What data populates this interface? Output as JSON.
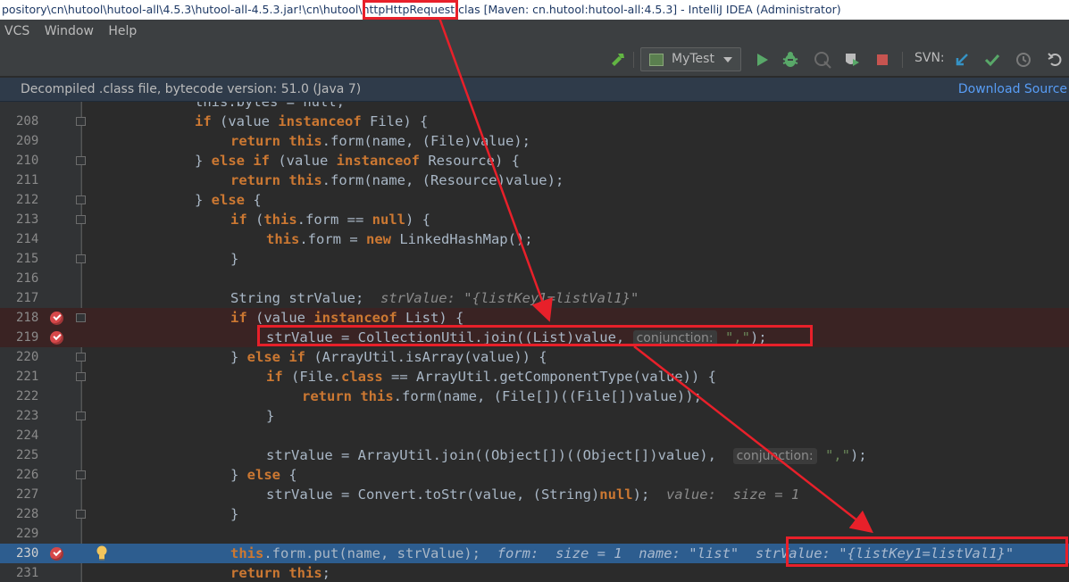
{
  "titlebar": {
    "text_before": "pository\\cn\\hutool\\hutool-all\\4.5.3\\hutool-all-4.5.3.jar!\\cn\\hutool\\http",
    "text_highlight": "HttpRequest.clas",
    "text_after": " [Maven: cn.hutool:hutool-all:4.5.3] - IntelliJ IDEA (Administrator)"
  },
  "menu": {
    "vcs": "VCS",
    "window": "Window",
    "help": "Help"
  },
  "toolbar": {
    "run_config": "MyTest",
    "svn_label": "SVN:"
  },
  "infobar": {
    "message": "Decompiled .class file, bytecode version: 51.0 (Java 7)",
    "download_link": "Download Source"
  },
  "code": {
    "l207": {
      "num": "",
      "text": "this.bytes = null;"
    },
    "l208": {
      "num": "208"
    },
    "l209": {
      "num": "209"
    },
    "l210": {
      "num": "210"
    },
    "l211": {
      "num": "211"
    },
    "l212": {
      "num": "212"
    },
    "l213": {
      "num": "213"
    },
    "l214": {
      "num": "214"
    },
    "l215": {
      "num": "215"
    },
    "l216": {
      "num": "216"
    },
    "l217": {
      "num": "217",
      "inline": "strValue: \"{listKey1=listVal1}\""
    },
    "l218": {
      "num": "218"
    },
    "l219": {
      "num": "219",
      "hint": "conjunction:",
      "str": "\",\""
    },
    "l220": {
      "num": "220"
    },
    "l221": {
      "num": "221"
    },
    "l222": {
      "num": "222"
    },
    "l223": {
      "num": "223"
    },
    "l224": {
      "num": "224"
    },
    "l225": {
      "num": "225",
      "hint": "conjunction:",
      "str": "\",\""
    },
    "l226": {
      "num": "226"
    },
    "l227": {
      "num": "227",
      "inline": "value:  size = 1"
    },
    "l228": {
      "num": "228"
    },
    "l229": {
      "num": "229"
    },
    "l230": {
      "num": "230",
      "inline1": "form:  size = 1  name: \"list\"",
      "inline2": "strValue: \"{listKey1=listVal1}\""
    },
    "l231": {
      "num": "231"
    }
  },
  "colors": {
    "keyword": "#cc7832",
    "string": "#6a8759",
    "field": "#9876aa",
    "current_line": "#2d5d8f",
    "breakpoint": "#d6484a",
    "annotation": "#e8202a"
  }
}
